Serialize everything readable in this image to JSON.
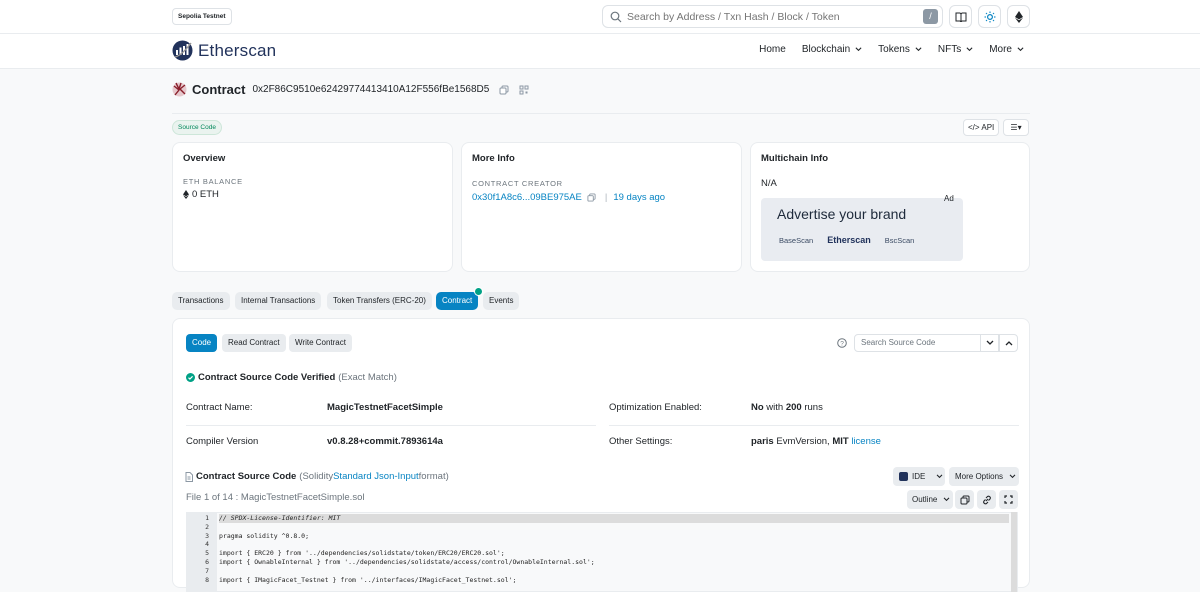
{
  "topbar": {
    "network_badge": "Sepolia Testnet",
    "search_placeholder": "Search by Address / Txn Hash / Block / Token",
    "search_shortcut": "/"
  },
  "navbar": {
    "brand": "Etherscan",
    "items": [
      {
        "label": "Home",
        "has_dropdown": false
      },
      {
        "label": "Blockchain",
        "has_dropdown": true
      },
      {
        "label": "Tokens",
        "has_dropdown": true
      },
      {
        "label": "NFTs",
        "has_dropdown": true
      },
      {
        "label": "More",
        "has_dropdown": true
      }
    ]
  },
  "header": {
    "title": "Contract",
    "address": "0x2F86C9510e62429774413410A12F556fBe1568D5"
  },
  "badges": {
    "source_code": "Source Code",
    "api": "API"
  },
  "overview": {
    "title": "Overview",
    "eth_balance_label": "ETH BALANCE",
    "eth_balance_value": "0 ETH"
  },
  "more_info": {
    "title": "More Info",
    "creator_label": "CONTRACT CREATOR",
    "creator_address": "0x30f1A8c6...09BE975AE",
    "separator": "|",
    "creator_age": "19 days ago"
  },
  "multichain": {
    "title": "Multichain Info",
    "value": "N/A",
    "ad_label": "Ad",
    "ad_title": "Advertise your brand",
    "ad_logos": [
      "BaseScan",
      "Etherscan",
      "BscScan"
    ]
  },
  "tabs": [
    "Transactions",
    "Internal Transactions",
    "Token Transfers (ERC-20)",
    "Contract",
    "Events"
  ],
  "active_tab": "Contract",
  "sub_tabs": [
    "Code",
    "Read Contract",
    "Write Contract"
  ],
  "source_search_placeholder": "Search Source Code",
  "verification": {
    "text": "Contract Source Code Verified",
    "match": "(Exact Match)"
  },
  "details": {
    "contract_name_label": "Contract Name:",
    "contract_name_value": "MagicTestnetFacetSimple",
    "compiler_label": "Compiler Version",
    "compiler_value": "v0.8.28+commit.7893614a",
    "optimization_label": "Optimization Enabled:",
    "optimization_no": "No",
    "optimization_with": " with ",
    "optimization_runs": "200",
    "optimization_runs_suffix": " runs",
    "other_label": "Other Settings:",
    "other_evm": "paris",
    "other_evm_suffix": " EvmVersion, ",
    "other_license": "MIT",
    "other_license_link": "license"
  },
  "source": {
    "title": "Contract Source Code",
    "format_prefix": "(Solidity ",
    "format_link": "Standard Json-Input",
    "format_suffix": " format)",
    "file_info": "File 1 of 14 : MagicTestnetFacetSimple.sol",
    "ide_label": "IDE",
    "more_options": "More Options",
    "outline": "Outline"
  },
  "code_lines": [
    {
      "n": "1",
      "t": "// SPDX-License-Identifier: MIT"
    },
    {
      "n": "2",
      "t": ""
    },
    {
      "n": "3",
      "t": "pragma solidity ^0.8.0;"
    },
    {
      "n": "4",
      "t": ""
    },
    {
      "n": "5",
      "t": "import { ERC20 } from '../dependencies/solidstate/token/ERC20/ERC20.sol';"
    },
    {
      "n": "6",
      "t": "import { OwnableInternal } from '../dependencies/solidstate/access/control/OwnableInternal.sol';"
    },
    {
      "n": "7",
      "t": ""
    },
    {
      "n": "8",
      "t": "import { IMagicFacet_Testnet } from '../interfaces/IMagicFacet_Testnet.sol';"
    }
  ],
  "colors": {
    "accent": "#0784c3",
    "success": "#00a186",
    "brand": "#21325b"
  }
}
